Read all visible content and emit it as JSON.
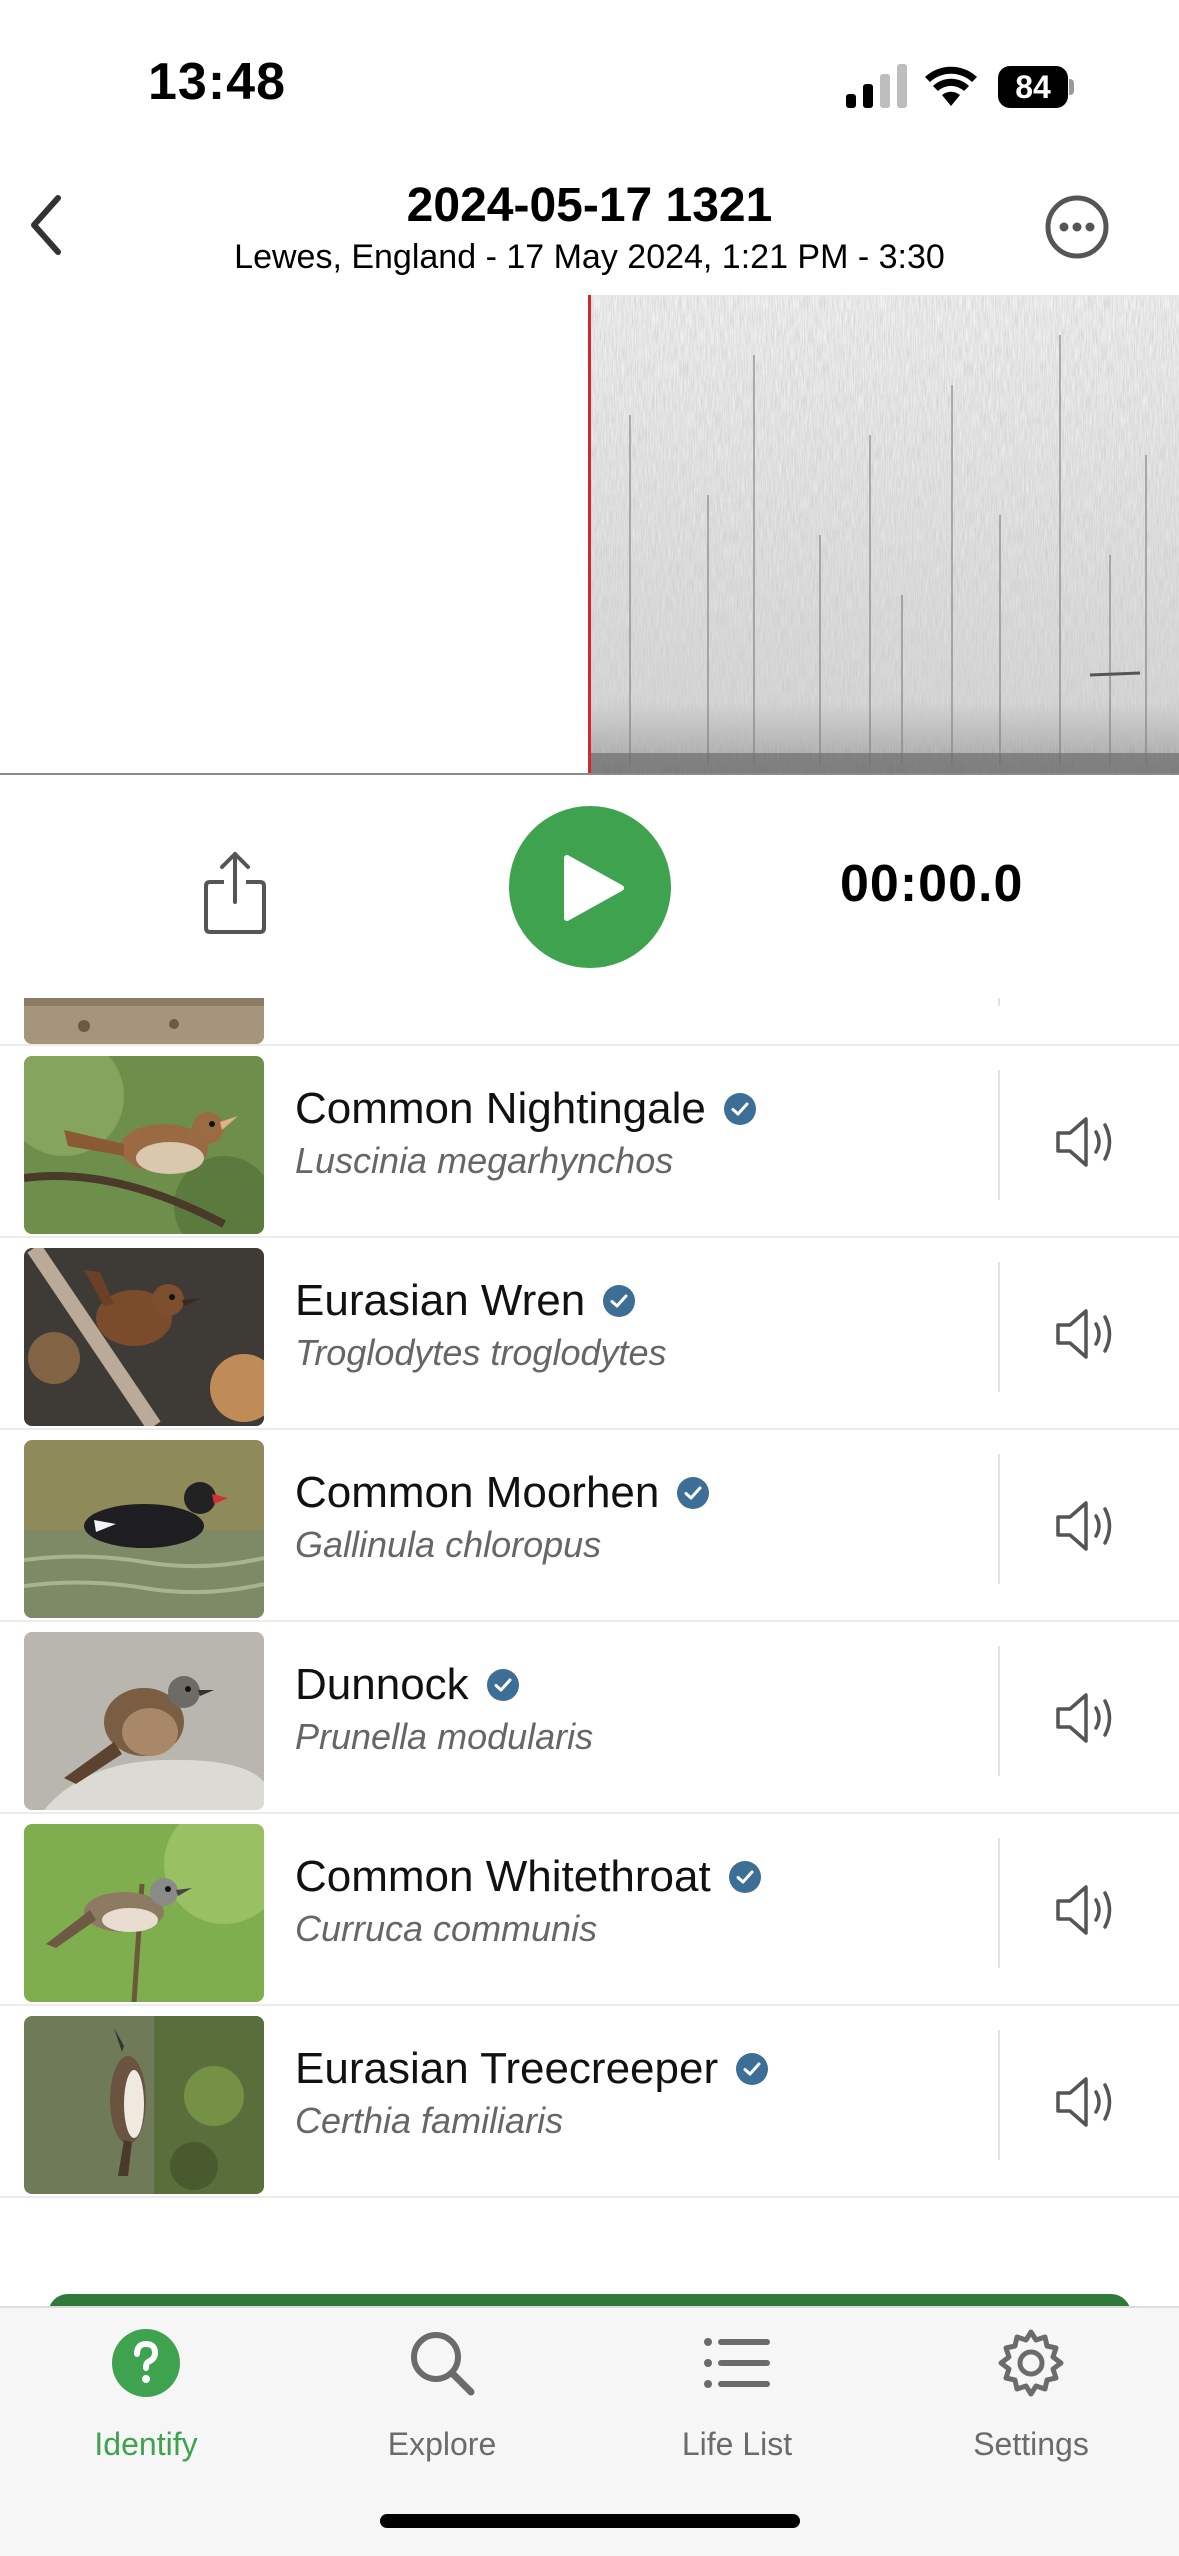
{
  "status_bar": {
    "time": "13:48",
    "battery": "84"
  },
  "header": {
    "title": "2024-05-17 1321",
    "subtitle": "Lewes, England - 17 May 2024, 1:21 PM - 3:30"
  },
  "player": {
    "time": "00:00.0"
  },
  "species": [
    {
      "common": "Common Nightingale",
      "scientific": "Luscinia megarhynchos"
    },
    {
      "common": "Eurasian Wren",
      "scientific": "Troglodytes troglodytes"
    },
    {
      "common": "Common Moorhen",
      "scientific": "Gallinula chloropus"
    },
    {
      "common": "Dunnock",
      "scientific": "Prunella modularis"
    },
    {
      "common": "Common Whitethroat",
      "scientific": "Curruca communis"
    },
    {
      "common": "Eurasian Treecreeper",
      "scientific": "Certhia familiaris"
    }
  ],
  "tabs": [
    {
      "label": "Identify",
      "icon": "question-icon",
      "active": true
    },
    {
      "label": "Explore",
      "icon": "search-icon",
      "active": false
    },
    {
      "label": "Life List",
      "icon": "list-icon",
      "active": false
    },
    {
      "label": "Settings",
      "icon": "gear-icon",
      "active": false
    }
  ],
  "colors": {
    "accent": "#3ea24f",
    "verified": "#3d6e95",
    "playhead": "#d7262b"
  }
}
